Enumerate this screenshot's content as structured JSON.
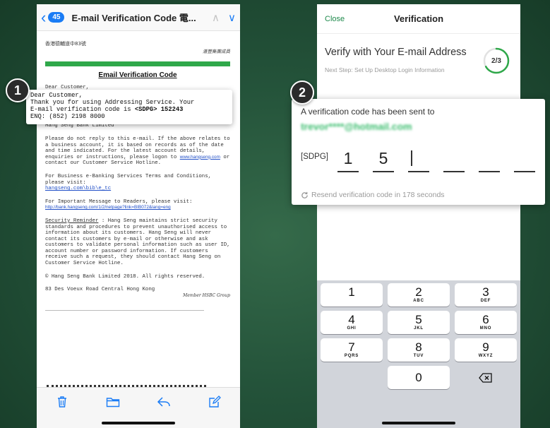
{
  "left_phone": {
    "nav": {
      "back_glyph": "‹",
      "unread_count": "45",
      "subject": "E-mail Verification Code 電...",
      "up_glyph": "∧",
      "down_glyph": "∨"
    },
    "email": {
      "address_cn": "香港德輔道中83號",
      "bank_cn": "滙豐集團成員",
      "title": "Email Verification Code",
      "greeting": "Dear Customer,",
      "line_bank": "Hang Seng Bank Limited",
      "do_not_reply": "Please do not reply to this e-mail. If the above relates to a business account, it is based on records as of the date and time indicated. For the latest account details, enquiries or instructions, please logon to",
      "website_link": "www.hangseng.com",
      "contact_tail": " or contact our Customer Service Hotline.",
      "terms_text": "For Business e-Banking Services Terms and Conditions, please visit:",
      "terms_link": "hangseng.com\\bib\\e_tc",
      "important_text": "For Important Message to Readers, please visit:",
      "important_link": "http://bank.hangseng.com/1/2/netpage?link=BIB072&lang=eng",
      "security_title": "Security Reminder",
      "security_text": ": Hang Seng maintains strict security standards and procedures to prevent unauthorised access to information about its customers. Hang Seng will never contact its customers by e-mail or otherwise and ask customers to validate personal information such as user ID, account number or password information. If customers receive such a request, they should contact Hang Seng on Customer Service Hotline.",
      "copyright": "© Hang Seng Bank Limited 2018. All rights reserved.",
      "footer_address": "83 Des Voeux Road Central Hong Kong",
      "member_text": "Member HSBC Group"
    },
    "popup": {
      "greeting": "Dear Customer,",
      "line1": "Thank you for using Addressing Service. Your",
      "line2_prefix": "E-mail verification code is ",
      "code": "<SDPG> 152243",
      "line3": "ENQ: (852) 2198 8000"
    },
    "step_number": "1"
  },
  "right_phone": {
    "nav": {
      "close_label": "Close",
      "title": "Verification"
    },
    "heading": "Verify with Your E-mail Address",
    "next_step": "Next Step: Set Up Desktop Login Information",
    "progress": {
      "label": "2/3",
      "fraction": 0.667
    },
    "popup": {
      "sent_text": "A verification code has been sent to",
      "email_masked": "trevor****@hotmail.com",
      "prefix": "[SDPG]",
      "digits": [
        "1",
        "5",
        "",
        "",
        "",
        ""
      ],
      "resend_text": "Resend verification code in 178 seconds"
    },
    "keypad": [
      {
        "digit": "1",
        "letters": ""
      },
      {
        "digit": "2",
        "letters": "ABC"
      },
      {
        "digit": "3",
        "letters": "DEF"
      },
      {
        "digit": "4",
        "letters": "GHI"
      },
      {
        "digit": "5",
        "letters": "JKL"
      },
      {
        "digit": "6",
        "letters": "MNO"
      },
      {
        "digit": "7",
        "letters": "PQRS"
      },
      {
        "digit": "8",
        "letters": "TUV"
      },
      {
        "digit": "9",
        "letters": "WXYZ"
      },
      {
        "digit": "0",
        "letters": ""
      }
    ],
    "step_number": "2"
  },
  "colors": {
    "ios_blue": "#1a7cf5",
    "hang_seng_green": "#1e8a4c",
    "progress_green": "#2fa84a",
    "background_green": "#24533a"
  },
  "icons": [
    "back-chevron-icon",
    "trash-icon",
    "folder-icon",
    "reply-icon",
    "compose-icon",
    "refresh-icon",
    "backspace-icon"
  ]
}
